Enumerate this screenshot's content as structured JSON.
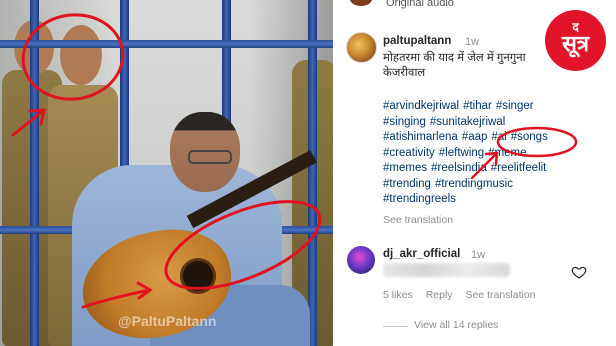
{
  "header": {
    "audio_label": "Original audio"
  },
  "post": {
    "username": "paltupaltann",
    "time": "1w",
    "caption_lines": [
      "मोहतरमा की याद में जेल में गुनगुना",
      "केजरीवाल"
    ],
    "hashtags": [
      "#arvindkejriwal",
      "#tihar",
      "#singer",
      "#singing",
      "#sunitakejriwal",
      "#atishimarlena",
      "#aap",
      "#ai",
      "#songs",
      "#creativity",
      "#leftwing",
      "#meme",
      "#memes",
      "#reelsindia",
      "#reelitfeelit",
      "#trending",
      "#trendingmusic",
      "#trendingreels"
    ],
    "see_translation": "See translation"
  },
  "comment": {
    "username": "dj_akr_official",
    "time": "1w",
    "likes": "5 likes",
    "reply": "Reply",
    "see_translation": "See translation",
    "view_replies": "View all 14 replies"
  },
  "photo": {
    "watermark": "@PaltuPaltann"
  },
  "logo": {
    "line1": "द",
    "line2": "सूत्र"
  },
  "colors": {
    "annotation": "#e3121f",
    "hashtag": "#00376b",
    "logo": "#e2142a",
    "bars": "#2b4d94"
  },
  "icons": [
    "heart-icon"
  ]
}
